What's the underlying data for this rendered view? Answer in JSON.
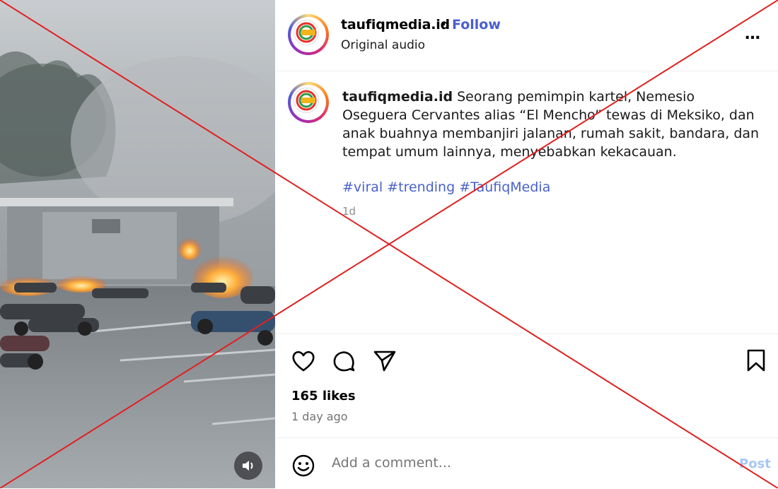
{
  "post": {
    "username": "taufiqmedia.id",
    "separator": "•",
    "follow_label": "Follow",
    "audio_label": "Original audio",
    "more_label": "…",
    "avatar_text": "TAUFIQ MEDIA",
    "caption_user": "taufiqmedia.id",
    "caption_text": " Seorang pemimpin kartel, Nemesio Oseguera Cervantes alias “El Mencho” tewas di Meksiko, dan anak buahnya membanjiri jalanan, rumah sakit, bandara, dan tempat umum lainnya, menyebabkan kekacauan.",
    "hashtags": "#viral #trending #TaufiqMedia",
    "relative_time": "1d",
    "likes": "165 likes",
    "posted_ago": "1 day ago"
  },
  "comment": {
    "placeholder": "Add a comment...",
    "post_label": "Post"
  },
  "icons": {
    "like": "heart-icon",
    "comment": "comment-icon",
    "share": "send-icon",
    "save": "bookmark-icon",
    "emoji": "emoji-icon",
    "audio": "speaker-icon"
  },
  "colors": {
    "follow": "#4a5fd0",
    "hashtag": "#4a62c9",
    "post_button": "#a8c6f5",
    "overlay_cross": "#e02020"
  }
}
